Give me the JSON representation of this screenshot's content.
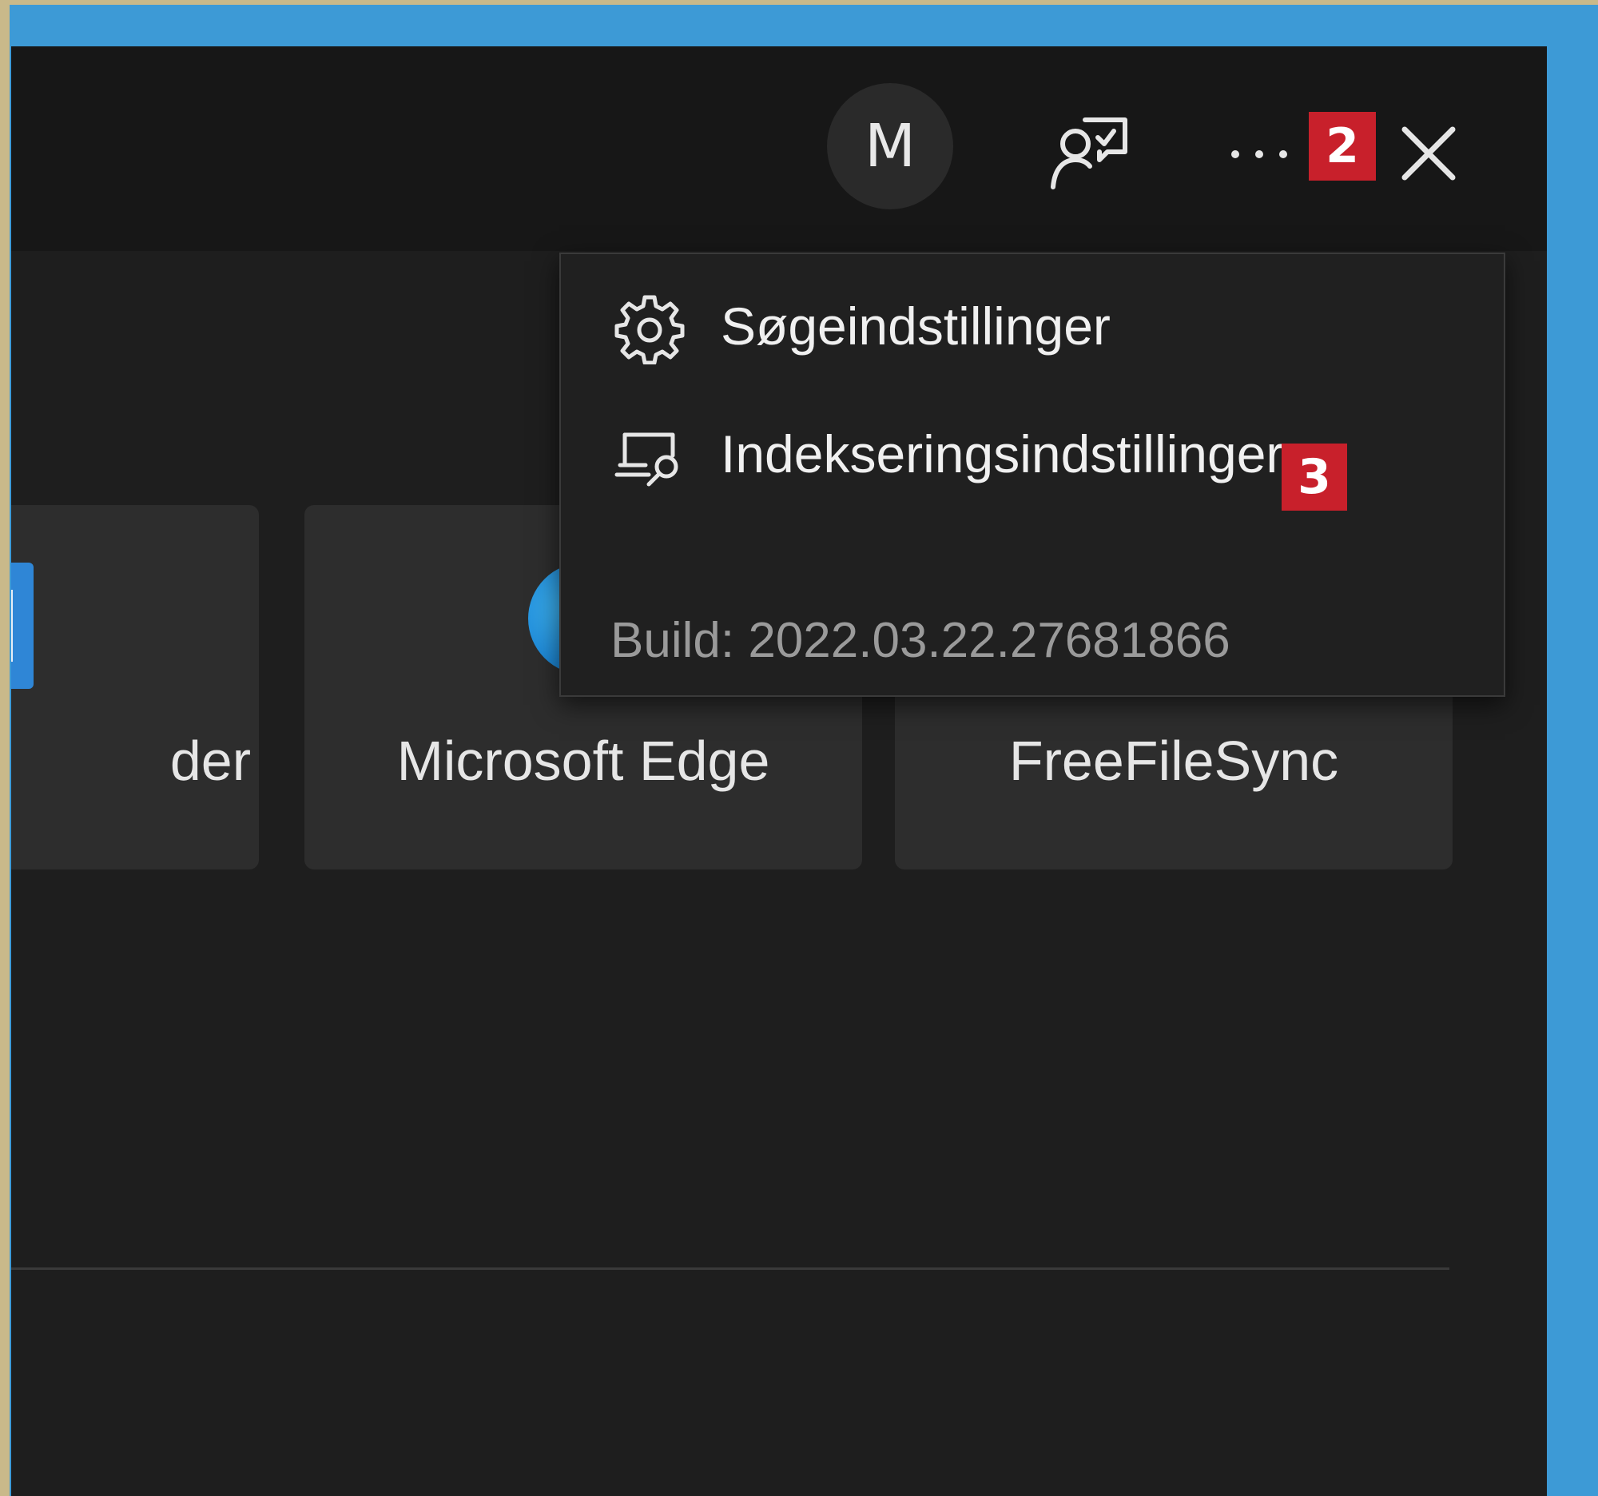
{
  "header": {
    "avatar_initial": "M",
    "more_badge": "2"
  },
  "results": {
    "cards": [
      {
        "label": "der"
      },
      {
        "label": "Microsoft Edge"
      },
      {
        "label": "FreeFileSync"
      }
    ]
  },
  "menu": {
    "items": [
      {
        "label": "Søgeindstillinger",
        "icon": "gear-icon"
      },
      {
        "label": "Indekseringsindstillinger",
        "icon": "indexing-icon",
        "badge": "3"
      }
    ],
    "build": "Build: 2022.03.22.27681866"
  },
  "colors": {
    "badge": "#c8202b",
    "window_bg": "#1e1e1e",
    "desktop_accent": "#3d9ad6"
  }
}
